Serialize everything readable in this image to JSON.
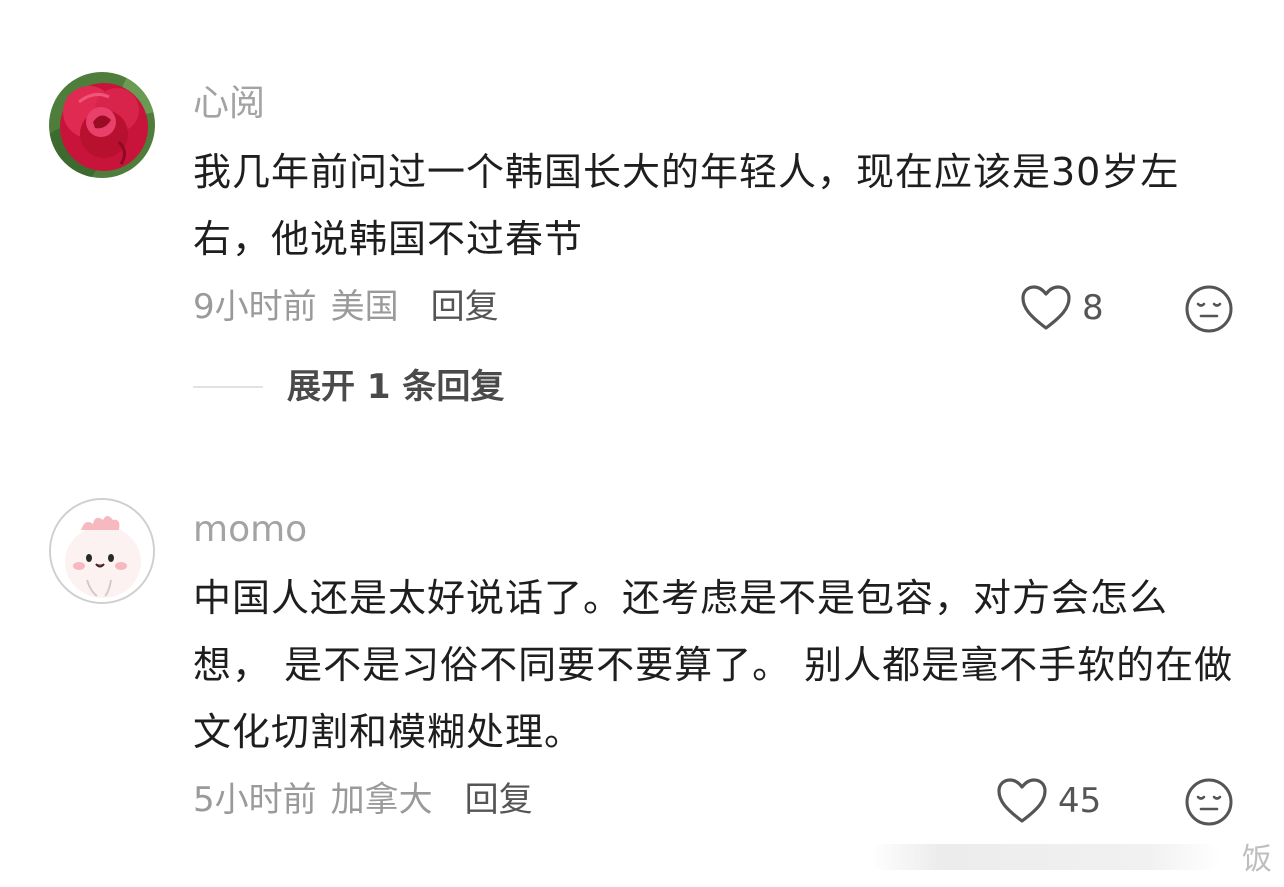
{
  "comments": [
    {
      "username": "心阅",
      "avatar_icon": "rose-avatar-icon",
      "content": "我几年前问过一个韩国长大的年轻人，现在应该是30岁左右，他说韩国不过春节",
      "time": "9小时前",
      "location": "美国",
      "reply_label": "回复",
      "like_count": "8",
      "expand_label": "展开 1 条回复"
    },
    {
      "username": "momo",
      "avatar_icon": "cartoon-dinosaur-avatar-icon",
      "content": "中国人还是太好说话了。还考虑是不是包容，对方会怎么想， 是不是习俗不同要不要算了。 别人都是毫不手软的在做文化切割和模糊处理。",
      "time": "5小时前",
      "location": "加拿大",
      "reply_label": "回复",
      "like_count": "45"
    }
  ],
  "watermark": {
    "text": "饭"
  },
  "colors": {
    "username": "#a3a3a3",
    "meta": "#9a9a9a",
    "reply": "#555555",
    "body_text": "#1e1e1e"
  }
}
